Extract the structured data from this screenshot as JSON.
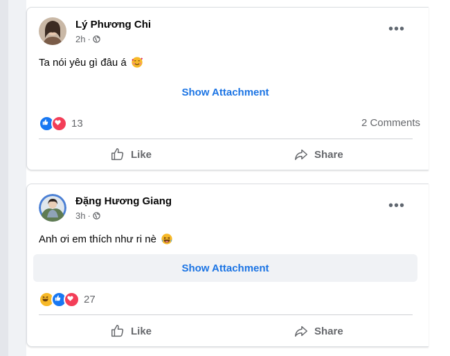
{
  "posts": [
    {
      "author": "Lý Phương Chi",
      "time": "2h",
      "separator": "·",
      "text": "Ta nói yêu gì đâu á",
      "emoji": "smiling-face-with-hearts-icon",
      "attachment_label": "Show Attachment",
      "reactions": [
        "like-reaction-icon",
        "love-reaction-icon"
      ],
      "reaction_count": "13",
      "comments_label": "2 Comments",
      "like_label": "Like",
      "share_label": "Share",
      "more_label": "•••"
    },
    {
      "author": "Đặng Hương Giang",
      "time": "3h",
      "separator": "·",
      "text": "Anh ơi em thích như ri nè",
      "emoji": "laughing-face-icon",
      "attachment_label": "Show Attachment",
      "reactions": [
        "haha-reaction-icon",
        "like-reaction-icon",
        "love-reaction-icon"
      ],
      "reaction_count": "27",
      "comments_label": "",
      "like_label": "Like",
      "share_label": "Share",
      "more_label": "•••"
    }
  ],
  "colors": {
    "link_blue": "#1b74e4",
    "secondary_text": "#65676b",
    "like_blue": "#1877f2",
    "love_red": "#f33e58",
    "haha_yellow": "#f7b928"
  }
}
